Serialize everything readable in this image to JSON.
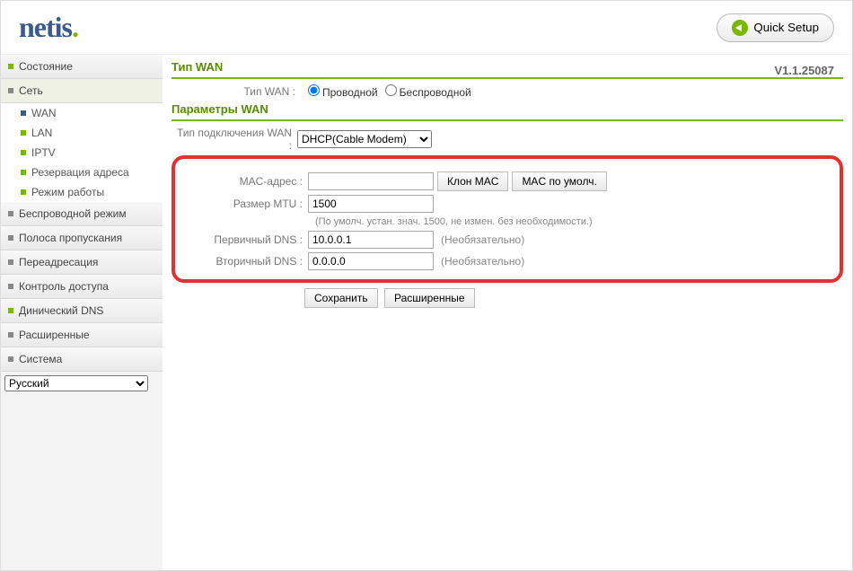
{
  "header": {
    "logo": "netis",
    "quick_setup": "Quick Setup",
    "version": "V1.1.25087"
  },
  "sidebar": {
    "status": "Состояние",
    "network": "Сеть",
    "network_sub": {
      "wan": "WAN",
      "lan": "LAN",
      "iptv": "IPTV",
      "reserve": "Резервация адреса",
      "mode": "Режим работы"
    },
    "wireless": "Беспроводной режим",
    "bandwidth": "Полоса пропускания",
    "forward": "Переадресация",
    "access": "Контроль доступа",
    "ddns": "Динический DNS",
    "advanced": "Расширенные",
    "system": "Система",
    "lang": "Русский"
  },
  "wan_type": {
    "title": "Тип WAN",
    "label": "Тип WAN :",
    "wired": "Проводной",
    "wireless": "Беспроводной"
  },
  "wan_params": {
    "title": "Параметры WAN",
    "conn_label": "Тип подключения WAN :",
    "conn_value": "DHCP(Cable Modem)",
    "mac_label": "MAC-адрес :",
    "mac_value": "",
    "clone_mac": "Клон MAC",
    "default_mac": "MAC по умолч.",
    "mtu_label": "Размер MTU :",
    "mtu_value": "1500",
    "mtu_note": "(По умолч. устан. знач. 1500, не измен. без необходимости.)",
    "dns1_label": "Первичный DNS :",
    "dns1_value": "10.0.0.1",
    "dns2_label": "Вторичный DNS :",
    "dns2_value": "0.0.0.0",
    "optional": "(Необязательно)",
    "save": "Сохранить",
    "adv": "Расширенные"
  }
}
